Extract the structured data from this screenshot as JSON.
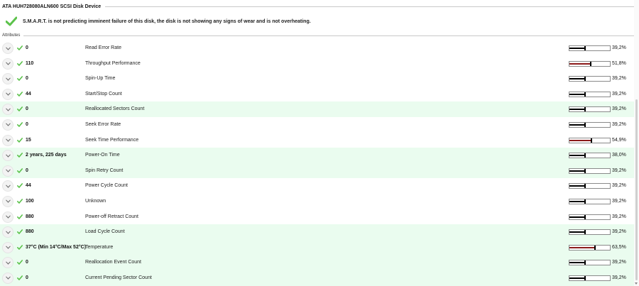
{
  "device": {
    "title": "ATA HUH728080ALN600 SCSI Disk Device"
  },
  "status": {
    "message": "S.M.A.R.T. is not predicting imminent failure of this disk, the disk is not showing any signs of wear and is not overheating."
  },
  "section": {
    "title": "Attributes"
  },
  "colors": {
    "check_green": "#5cc24b",
    "highlight_row": "#eafcef",
    "bar_line_dark": "#000000",
    "bar_line_red": "#8b1a1a"
  },
  "icons": {
    "status": "checkmark-icon",
    "row_status": "checkmark-icon",
    "expander": "chevron-down-icon"
  },
  "attributes": [
    {
      "value": "0",
      "name": "Read Error Rate",
      "percent": "39,2%",
      "level": 0.392,
      "highlight": false
    },
    {
      "value": "110",
      "name": "Throughput Performance",
      "percent": "51,8%",
      "level": 0.518,
      "highlight": false
    },
    {
      "value": "0",
      "name": "Spin-Up Time",
      "percent": "39,2%",
      "level": 0.392,
      "highlight": false
    },
    {
      "value": "44",
      "name": "Start/Stop Count",
      "percent": "39,2%",
      "level": 0.392,
      "highlight": false
    },
    {
      "value": "0",
      "name": "Reallocated Sectors Count",
      "percent": "39,2%",
      "level": 0.392,
      "highlight": true
    },
    {
      "value": "0",
      "name": "Seek Error Rate",
      "percent": "39,2%",
      "level": 0.392,
      "highlight": false
    },
    {
      "value": "15",
      "name": "Seek Time Performance",
      "percent": "54,9%",
      "level": 0.549,
      "highlight": false
    },
    {
      "value": "2 years, 225 days",
      "name": "Power-On Time",
      "percent": "38,0%",
      "level": 0.38,
      "highlight": true
    },
    {
      "value": "0",
      "name": "Spin Retry Count",
      "percent": "39,2%",
      "level": 0.392,
      "highlight": true
    },
    {
      "value": "44",
      "name": "Power Cycle Count",
      "percent": "39,2%",
      "level": 0.392,
      "highlight": false
    },
    {
      "value": "100",
      "name": "Unknown",
      "percent": "39,2%",
      "level": 0.392,
      "highlight": false
    },
    {
      "value": "880",
      "name": "Power-off Retract Count",
      "percent": "39,2%",
      "level": 0.392,
      "highlight": false
    },
    {
      "value": "880",
      "name": "Load Cycle Count",
      "percent": "39,2%",
      "level": 0.392,
      "highlight": true
    },
    {
      "value": "37°C (Min 14°C/Max 52°C)",
      "name": "Temperature",
      "percent": "63,5%",
      "level": 0.635,
      "highlight": true
    },
    {
      "value": "0",
      "name": "Reallocation Event Count",
      "percent": "39,2%",
      "level": 0.392,
      "highlight": true
    },
    {
      "value": "0",
      "name": "Current Pending Sector Count",
      "percent": "39,2%",
      "level": 0.392,
      "highlight": true
    }
  ]
}
